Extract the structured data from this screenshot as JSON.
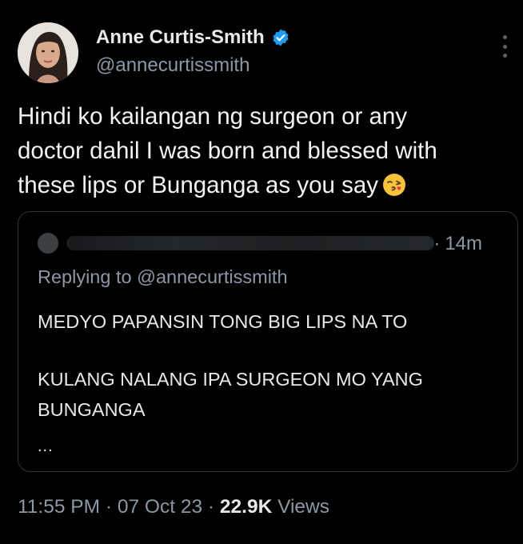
{
  "author": {
    "display_name": "Anne Curtis-Smith",
    "handle": "@annecurtissmith",
    "verified": true,
    "verified_color": "#1d9bf0"
  },
  "tweet": {
    "text": "Hindi ko kailangan ng surgeon or any\ndoctor dahil I was born and blessed with\nthese lips or Bunganga as you say",
    "emoji": "face-throwing-kiss"
  },
  "quoted": {
    "time": "14m",
    "time_separator": "·",
    "replying_to": "Replying to @annecurtissmith",
    "line1": "MEDYO PAPANSIN TONG BIG LIPS NA TO",
    "line2": "KULANG NALANG IPA SURGEON MO YANG BUNGANGA",
    "ellipsis": "..."
  },
  "meta": {
    "time": "11:55 PM",
    "date": "07 Oct 23",
    "separator": "·",
    "views_count": "22.9K",
    "views_label": "Views"
  },
  "colors": {
    "background": "#000000",
    "primary_text": "#e7e9ea",
    "secondary_text": "#8b98a5",
    "border": "#2f3336"
  },
  "icons": {
    "verified": "verified-badge-icon",
    "more": "more-options-icon",
    "emoji": "kissing-face-emoji"
  }
}
